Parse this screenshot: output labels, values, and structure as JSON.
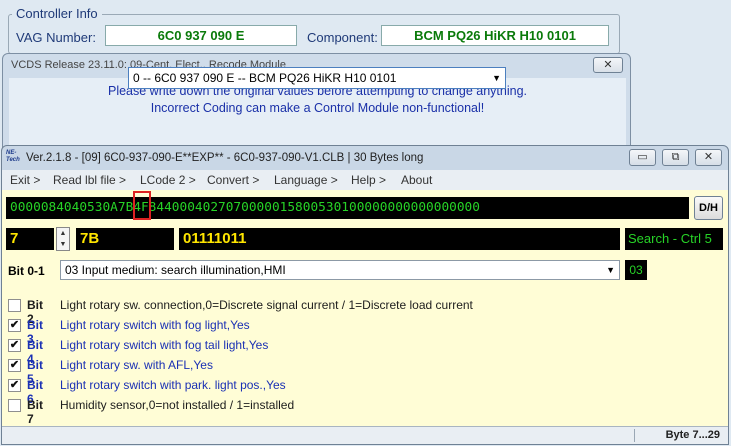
{
  "controller_info": {
    "legend": "Controller Info",
    "vag_label": "VAG Number:",
    "vag_value": "6C0 937 090 E",
    "component_label": "Component:",
    "component_value": "BCM PQ26 HiKR H10 0101"
  },
  "recode_window": {
    "title": "VCDS Release 23.11.0: 09-Cent. Elect.,  Recode Module",
    "close": "✕",
    "warning_line1": "Please write down the original values before attempting to change anything.",
    "warning_line2": "Incorrect Coding can make a Control Module non-functional!",
    "module_select": "0 -- 6C0 937 090 E -- BCM PQ26 HiKR H10 0101"
  },
  "coding_window": {
    "logo": "NE-Tech",
    "title": "Ver.2.1.8 - [09] 6C0-937-090-E**EXP** - 6C0-937-090-V1.CLB | 30 Bytes long",
    "buttons": {
      "minimize": "▭",
      "restore": "⧉",
      "close": "✕"
    },
    "menu": [
      "Exit >",
      "Read lbl file >",
      "LCode 2 >",
      "Convert >",
      "Language >",
      "Help >",
      "About"
    ],
    "hex_string": "0000084040530A7B4F8440004027070000015800530100000000000000000",
    "dh_button": "D/H",
    "byte_number": "7",
    "hex_value": "7B",
    "binary_value": "01111011",
    "search_label": "Search - Ctrl 5",
    "bit01": {
      "label": "Bit 0-1",
      "selected": "03 Input medium: search illumination,HMI",
      "value": "03"
    },
    "bits": [
      {
        "label": "Bit 2",
        "checked": false,
        "desc": "Light rotary sw. connection,0=Discrete signal current / 1=Discrete load current"
      },
      {
        "label": "Bit 3",
        "checked": true,
        "desc": "Light rotary switch with fog light,Yes"
      },
      {
        "label": "Bit 4",
        "checked": true,
        "desc": "Light rotary switch with fog tail light,Yes"
      },
      {
        "label": "Bit 5",
        "checked": true,
        "desc": "Light rotary sw. with AFL,Yes"
      },
      {
        "label": "Bit 6",
        "checked": true,
        "desc": "Light rotary switch with park. light pos.,Yes"
      },
      {
        "label": "Bit 7",
        "checked": false,
        "desc": "Humidity sensor,0=not installed / 1=installed"
      }
    ],
    "status": "Byte 7...29"
  },
  "colors": {
    "hex_green": "#27d327",
    "byte_yellow": "#ffe600",
    "checked_blue": "#1a30b4",
    "pane_bg": "#fffdd6"
  }
}
